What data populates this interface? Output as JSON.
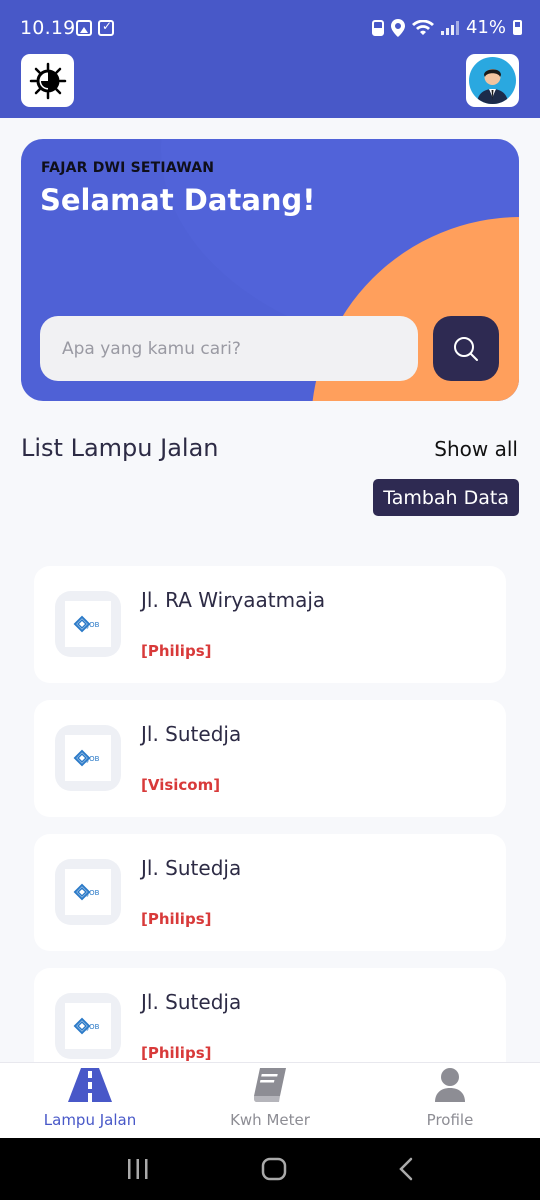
{
  "status_bar": {
    "time": "10.19",
    "battery": "41%"
  },
  "header": {
    "logo_icon": "brightness-icon",
    "avatar_icon": "user-avatar-icon"
  },
  "hero": {
    "user_name": "FAJAR DWI SETIAWAN",
    "greeting": "Selamat Datang!",
    "search_placeholder": "Apa yang kamu cari?"
  },
  "section": {
    "title": "List Lampu Jalan",
    "show_all": "Show all",
    "add_button": "Tambah Data"
  },
  "items": [
    {
      "name": "Jl. RA Wiryaatmaja",
      "brand": "[Philips]"
    },
    {
      "name": "Jl. Sutedja",
      "brand": "[Visicom]"
    },
    {
      "name": "Jl. Sutedja",
      "brand": "[Philips]"
    },
    {
      "name": "Jl. Sutedja",
      "brand": "[Philips]"
    }
  ],
  "nav": [
    {
      "label": "Lampu Jalan",
      "icon": "road-icon",
      "active": true
    },
    {
      "label": "Kwh Meter",
      "icon": "book-icon",
      "active": false
    },
    {
      "label": "Profile",
      "icon": "person-icon",
      "active": false
    }
  ],
  "colors": {
    "primary": "#4858c8",
    "dark": "#2e2a52",
    "accent_orange": "#ff9f5c",
    "brand_red": "#d83a3a"
  }
}
